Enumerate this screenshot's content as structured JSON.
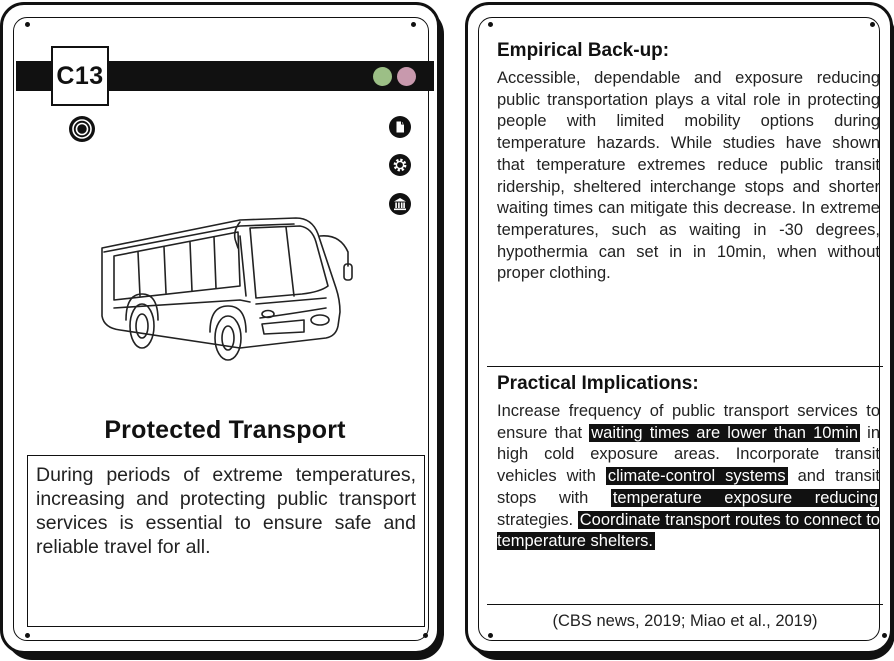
{
  "left_card": {
    "code": "C13",
    "dot_colors": [
      "#9cbf86",
      "#c899ad"
    ],
    "level_icon": "target-icon",
    "category_icons": [
      "document-icon",
      "gear-icon",
      "institution-icon"
    ],
    "illustration": "bus-icon",
    "title": "Protected Transport",
    "description": "During periods of extreme temperatures, increasing and protecting public transport services is essential to ensure safe and reliable travel for all."
  },
  "right_card": {
    "empirical": {
      "heading": "Empirical Back-up:",
      "body": "Accessible, dependable and exposure reducing public transportation plays a vital role in protecting people with limited mobility options during temperature hazards. While studies have shown that temperature extremes reduce public transit ridership, sheltered interchange stops and shorter waiting times can mitigate this decrease. In extreme temperatures, such as waiting in -30 degrees, hypothermia can set in in 10min, when without proper clothing."
    },
    "practical": {
      "heading": "Practical Implications:",
      "p1": "Increase frequency of public transport services to ensure that ",
      "h1": "waiting times are lower than 10min",
      "p2": " in high cold exposure areas. Incorporate transit vehicles with ",
      "h2": "climate-control systems",
      "p3": " and transit stops with ",
      "h3": "temperature exposure reducing",
      "p4": " strategies. ",
      "h4": "Coordinate transport routes to connect to temperature shelters."
    },
    "citation": "(CBS news, 2019; Miao et al., 2019)"
  }
}
